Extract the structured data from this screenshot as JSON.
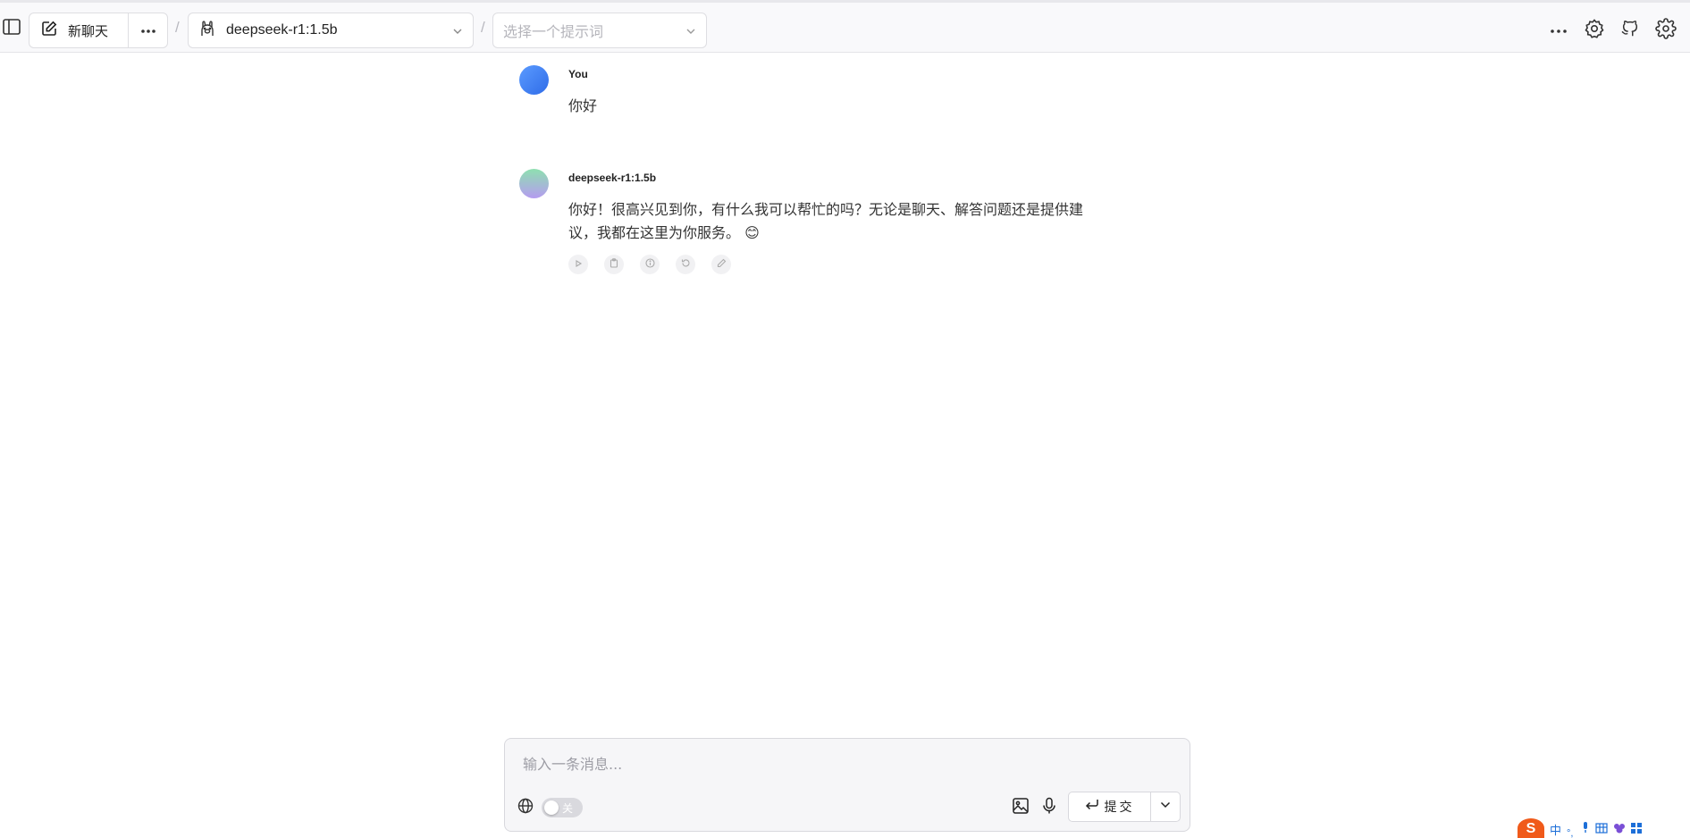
{
  "header": {
    "new_chat_label": "新聊天",
    "model_name": "deepseek-r1:1.5b",
    "prompt_placeholder": "选择一个提示词",
    "separator": "/"
  },
  "messages": [
    {
      "role": "user",
      "sender": "You",
      "text": "你好"
    },
    {
      "role": "assistant",
      "sender": "deepseek-r1:1.5b",
      "line1": "你好！很高兴见到你，有什么我可以帮忙的吗？无论是聊天、解答问题还是提供建",
      "line2": "议，我都在这里为你服务。",
      "emoji": "😊"
    }
  ],
  "composer": {
    "placeholder": "输入一条消息...",
    "web_search_toggle_label": "关",
    "submit_label": "提交"
  },
  "ime_tray": {
    "mode_label": "中"
  },
  "colors": {
    "user_avatar": "#3b7bf0",
    "bot_avatar_top": "#8ee0b0",
    "bot_avatar_bottom": "#b59cf0",
    "ime_brand": "#f05a1a"
  }
}
